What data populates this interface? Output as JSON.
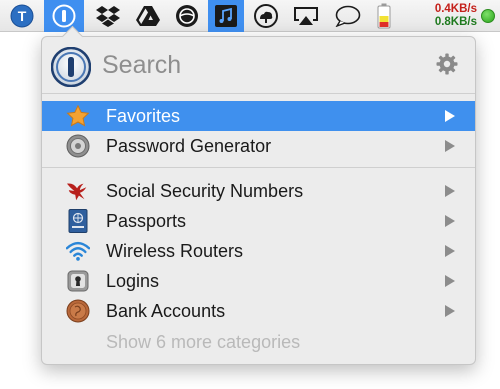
{
  "menubar": {
    "icons": [
      "typinator-icon",
      "onepassword-icon",
      "dropbox-icon",
      "google-drive-icon",
      "round-app-icon",
      "music-icon",
      "cloud-app-icon",
      "airplay-icon",
      "speech-bubble-icon",
      "battery-icon"
    ],
    "net_up": "0.4KB/s",
    "net_down": "0.8KB/s",
    "status_dot_color": "#2aa51b",
    "active_color": "#3f8ff0"
  },
  "popup": {
    "search_placeholder": "Search",
    "items": [
      {
        "label": "Favorites",
        "icon": "star-icon",
        "selected": true
      },
      {
        "label": "Password Generator",
        "icon": "vault-dial-icon",
        "selected": false
      },
      {
        "label": "Social Security Numbers",
        "icon": "eagle-icon",
        "selected": false
      },
      {
        "label": "Passports",
        "icon": "passport-icon",
        "selected": false
      },
      {
        "label": "Wireless Routers",
        "icon": "wifi-icon",
        "selected": false
      },
      {
        "label": "Logins",
        "icon": "keyhole-icon",
        "selected": false
      },
      {
        "label": "Bank Accounts",
        "icon": "coin-icon",
        "selected": false
      }
    ],
    "more_label": "Show 6 more categories",
    "selection_color": "#3f90ee"
  }
}
